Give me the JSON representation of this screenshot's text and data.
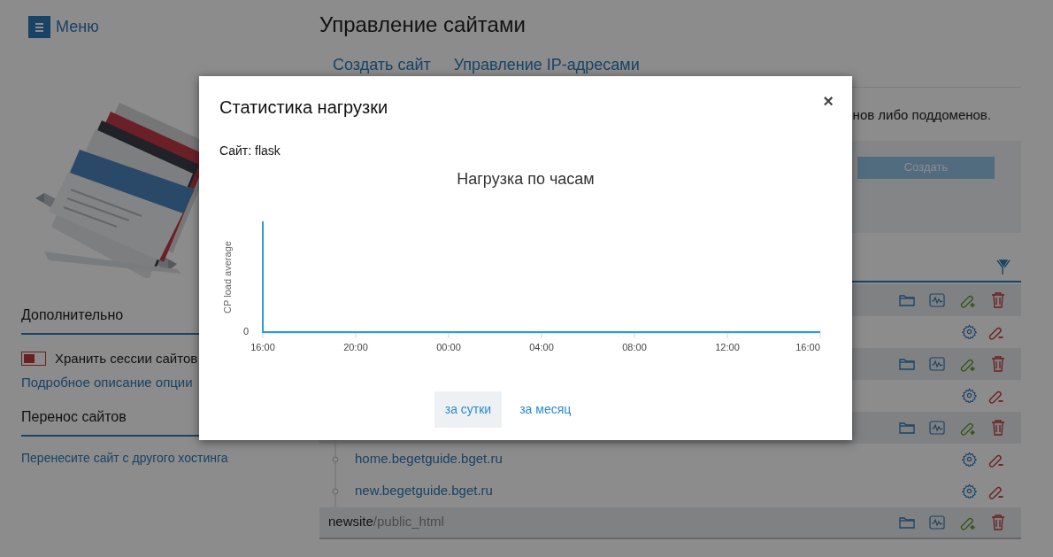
{
  "menu_button": {
    "label": "Меню"
  },
  "page_title": "Управление сайтами",
  "tabs": [
    {
      "label": "Создать сайт",
      "selected": false
    },
    {
      "label": "Управление IP-адресами",
      "selected": false
    }
  ],
  "description": "нов либо поддоменов.",
  "create_form": {
    "button": "Создать"
  },
  "sidebar": {
    "extra_title": "Дополнительно",
    "session_toggle": {
      "label": "Хранить сессии сайтов",
      "on": false
    },
    "option_link": "Подробное описание опции",
    "transfer_title": "Перенос сайтов",
    "transfer_link": "Перенесите сайт с другого хостинга"
  },
  "site_rows": [
    {
      "kind": "site"
    },
    {
      "kind": "domain"
    },
    {
      "kind": "site"
    },
    {
      "kind": "domain"
    },
    {
      "kind": "site"
    },
    {
      "kind": "domain",
      "name": "home.begetguide.bget.ru"
    },
    {
      "kind": "domain",
      "name": "new.begetguide.bget.ru"
    },
    {
      "kind": "site",
      "name": "newsite",
      "path": "/public_html"
    }
  ],
  "dialog": {
    "title": "Статистика нагрузки",
    "close": "×",
    "site_label": "Сайт: flask",
    "chart": {
      "title": "Нагрузка по часам",
      "y_axis_label": "CP load average",
      "y_tick": "0",
      "x_labels": [
        "16:00",
        "20:00",
        "00:00",
        "04:00",
        "08:00",
        "12:00",
        "16:00"
      ]
    },
    "periods": [
      {
        "label": "за сутки",
        "selected": true
      },
      {
        "label": "за месяц",
        "selected": false
      }
    ]
  }
}
